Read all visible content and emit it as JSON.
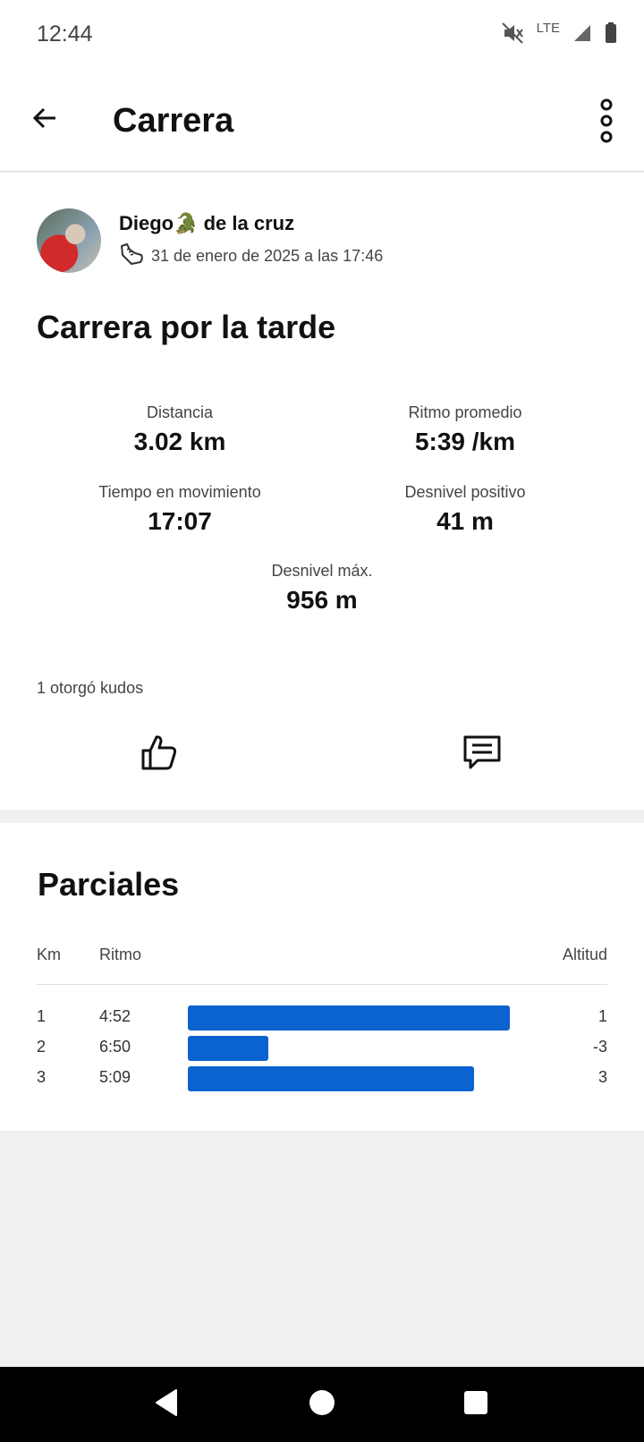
{
  "status_bar": {
    "time": "12:44",
    "network": "LTE"
  },
  "app_bar": {
    "title": "Carrera"
  },
  "activity": {
    "athlete_name": "Diego🐊 de la cruz",
    "date": "31 de enero de 2025 a las 17:46",
    "title": "Carrera por la tarde",
    "stats": [
      {
        "label": "Distancia",
        "value": "3.02 km"
      },
      {
        "label": "Ritmo promedio",
        "value": "5:39 /km"
      },
      {
        "label": "Tiempo en movimiento",
        "value": "17:07"
      },
      {
        "label": "Desnivel positivo",
        "value": "41 m"
      },
      {
        "label": "Desnivel máx.",
        "value": "956 m"
      }
    ],
    "kudos_text": "1 otorgó kudos"
  },
  "splits": {
    "title": "Parciales",
    "headers": {
      "km": "Km",
      "pace": "Ritmo",
      "elevation": "Altitud"
    },
    "rows": [
      {
        "km": "1",
        "pace": "4:52",
        "elevation": "1",
        "bar_fraction": 1.0
      },
      {
        "km": "2",
        "pace": "6:50",
        "elevation": "-3",
        "bar_fraction": 0.25
      },
      {
        "km": "3",
        "pace": "5:09",
        "elevation": "3",
        "bar_fraction": 0.89
      }
    ]
  },
  "colors": {
    "accent": "#0b63cf",
    "background": "#f0f0f0"
  },
  "icons": [
    "back-arrow-icon",
    "more-vertical-icon",
    "running-shoe-icon",
    "thumbs-up-icon",
    "comment-icon",
    "nav-back-icon",
    "nav-home-icon",
    "nav-recents-icon"
  ]
}
